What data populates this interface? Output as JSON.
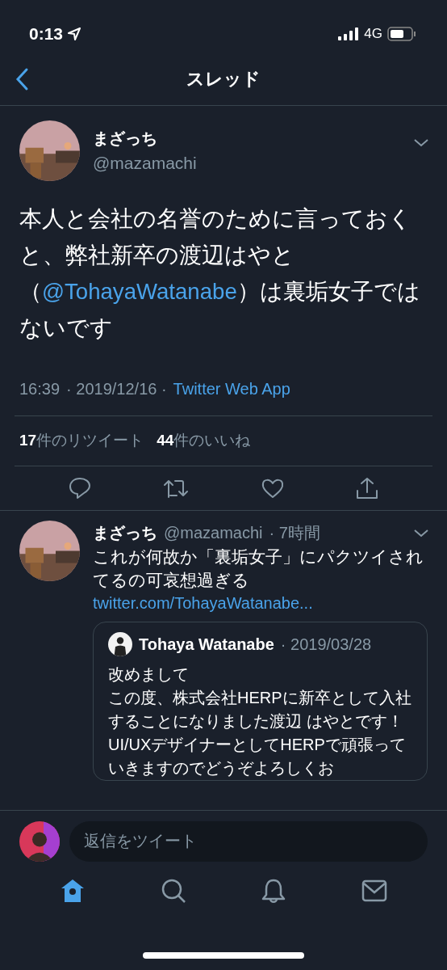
{
  "status_bar": {
    "time": "0:13",
    "network": "4G"
  },
  "header": {
    "title": "スレッド"
  },
  "tweet": {
    "name": "まざっち",
    "handle": "@mazamachi",
    "segments": [
      {
        "kind": "text",
        "text": "本人と会社の名誉のために言っておくと、弊社新卒の渡辺はやと（"
      },
      {
        "kind": "mention",
        "text": "@TohayaWatanabe"
      },
      {
        "kind": "text",
        "text": "）は裏垢女子ではないです"
      }
    ],
    "time": "16:39",
    "date": "· 2019/12/16 ·",
    "source": "Twitter Web App",
    "stats": [
      {
        "count": "17",
        "label": "件のリツイート"
      },
      {
        "count": "44",
        "label": "件のいいね"
      }
    ]
  },
  "reply": {
    "name": "まざっち",
    "handle": "@mazamachi",
    "time": "· 7時間",
    "text": "これが何故か「裏垢女子」にパクツイされてるの可哀想過ぎる",
    "link": "twitter.com/TohayaWatanabe...",
    "quote": {
      "name": "Tohaya Watanabe",
      "date": "· 2019/03/28",
      "lines": [
        "改めまして",
        "この度、株式会社HERPに新卒として入社することになりました渡辺 はやとです！UI/UXデザイナーとしてHERPで頑張っていきますのでどうぞよろしくお"
      ]
    }
  },
  "composer": {
    "placeholder": "返信をツイート"
  },
  "tab_bar": [
    {
      "kind": "home",
      "selected": true
    },
    {
      "kind": "search",
      "selected": false
    },
    {
      "kind": "notifications",
      "selected": false
    },
    {
      "kind": "messages",
      "selected": false
    }
  ]
}
